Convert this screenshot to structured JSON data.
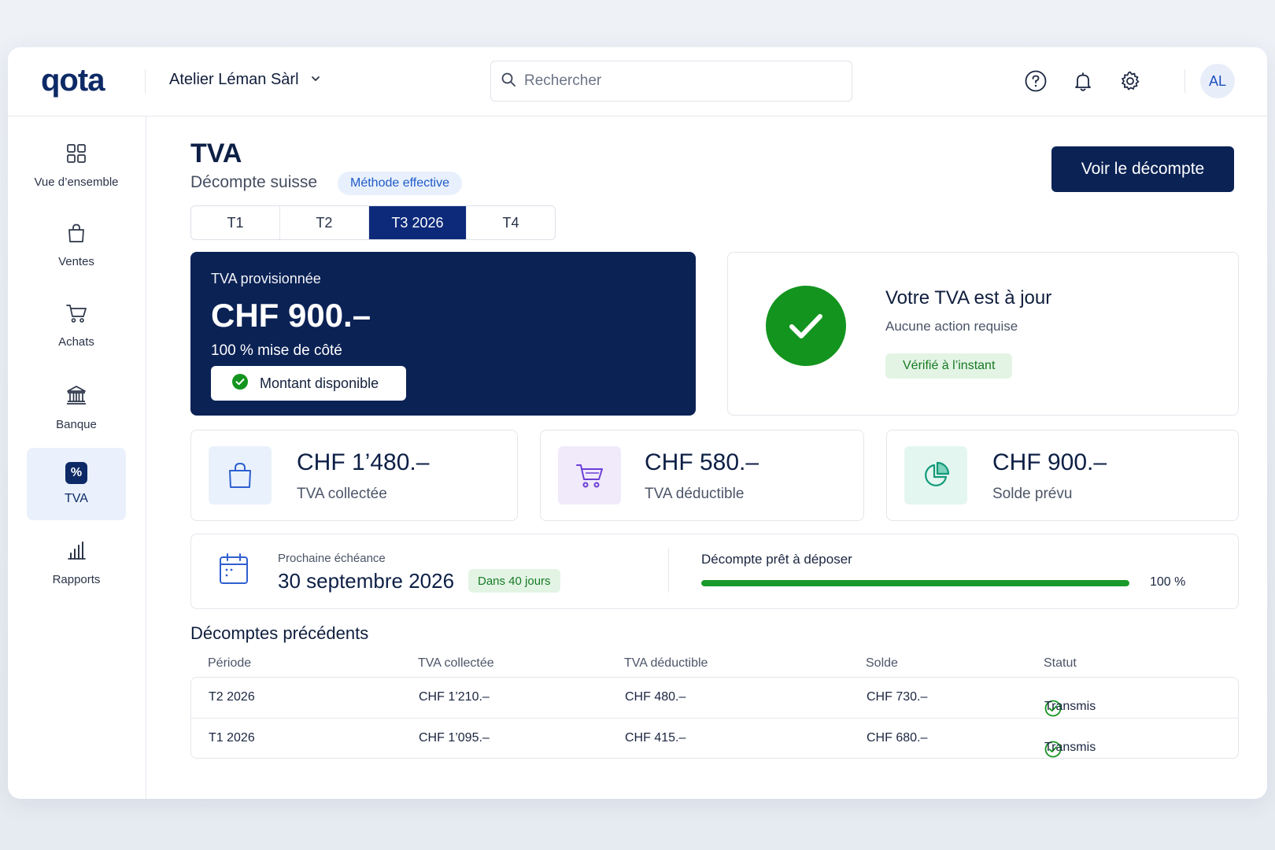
{
  "app": {
    "logo": "qota",
    "organization": "Atelier Léman Sàrl",
    "search_placeholder": "Rechercher",
    "avatar_initials": "AL"
  },
  "sidebar": {
    "items": [
      {
        "label": "Vue d’ensemble",
        "icon": "grid-icon"
      },
      {
        "label": "Ventes",
        "icon": "shopping-bag-icon"
      },
      {
        "label": "Achats",
        "icon": "cart-icon"
      },
      {
        "label": "Banque",
        "icon": "bank-icon"
      },
      {
        "label": "TVA",
        "icon": "percent-icon",
        "active": true
      },
      {
        "label": "Rapports",
        "icon": "bar-chart-icon"
      }
    ]
  },
  "page": {
    "title": "TVA",
    "subtitle": "Décompte suisse",
    "method": "Méthode effective",
    "cta": "Voir le décompte",
    "tabs": [
      {
        "label": "T1"
      },
      {
        "label": "T2"
      },
      {
        "label": "T3 2026",
        "active": true
      },
      {
        "label": "T4"
      }
    ]
  },
  "provision": {
    "label": "TVA provisionnée",
    "amount": "CHF 900.–",
    "set_aside": "100 % mise de côté",
    "chip": "Montant disponible"
  },
  "status": {
    "title": "Votre TVA est à jour",
    "subtitle": "Aucune action requise",
    "badge": "Vérifié à l’instant"
  },
  "stats": [
    {
      "value": "CHF 1’480.–",
      "caption": "TVA collectée",
      "icon": "shopping-bag-icon",
      "color": "#2f5fd0",
      "bg": "#e9f1fc"
    },
    {
      "value": "CHF 580.–",
      "caption": "TVA déductible",
      "icon": "cart-icon",
      "color": "#6b3fd4",
      "bg": "#f0eafb"
    },
    {
      "value": "CHF 900.–",
      "caption": "Solde prévu",
      "icon": "pie-chart-icon",
      "color": "#129a7a",
      "bg": "#e4f6f0"
    }
  ],
  "deadline": {
    "label": "Prochaine échéance",
    "date": "30 septembre 2026",
    "badge": "Dans 40 jours",
    "progress_label": "Décompte prêt à déposer",
    "progress_percent": 100,
    "progress_text": "100 %"
  },
  "history": {
    "title": "Décomptes précédents",
    "columns": [
      "Période",
      "TVA collectée",
      "TVA déductible",
      "Solde",
      "Statut"
    ],
    "rows": [
      {
        "period": "T2 2026",
        "collected": "CHF 1’210.–",
        "deductible": "CHF 480.–",
        "balance": "CHF 730.–",
        "status": "Transmis"
      },
      {
        "period": "T1 2026",
        "collected": "CHF 1’095.–",
        "deductible": "CHF 415.–",
        "balance": "CHF 680.–",
        "status": "Transmis"
      }
    ]
  },
  "colors": {
    "navy": "#0b2255",
    "success": "#13941f",
    "accent": "#1f5bc6"
  }
}
